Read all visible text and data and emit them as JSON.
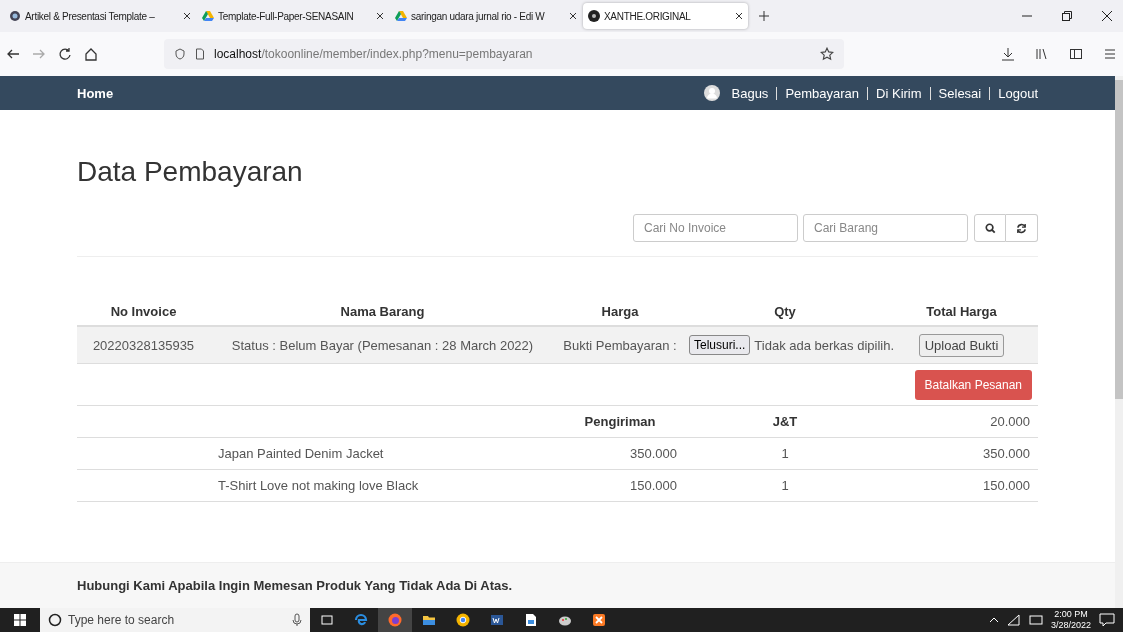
{
  "browser": {
    "tabs": [
      {
        "title": "Artikel & Presentasi Template – ",
        "kind": "globe",
        "selected": false
      },
      {
        "title": "Template-Full-Paper-SENASAIN",
        "kind": "drive",
        "selected": false
      },
      {
        "title": "saringan udara jurnal rio - Edi W",
        "kind": "drive",
        "selected": false
      },
      {
        "title": "XANTHE.ORIGINAL",
        "kind": "logo",
        "selected": true
      }
    ],
    "address": {
      "host": "localhost",
      "path": "/tokoonline/member/index.php?menu=pembayaran"
    }
  },
  "nav": {
    "brand": "Home",
    "user": "Bagus",
    "links": [
      "Pembayaran",
      "Di Kirim",
      "Selesai",
      "Logout"
    ]
  },
  "page": {
    "title": "Data Pembayaran",
    "search": {
      "invoice_placeholder": "Cari No Invoice",
      "item_placeholder": "Cari Barang"
    },
    "table": {
      "columns": [
        "No Invoice",
        "Nama Barang",
        "Harga",
        "Qty",
        "Total Harga"
      ],
      "order": {
        "invoice": "20220328135935",
        "status": "Status : Belum Bayar (Pemesanan : 28 March 2022)",
        "proof_label": "Bukti Pembayaran :",
        "file_button": "Telusuri...",
        "file_status": "Tidak ada berkas dipilih.",
        "upload_button": "Upload Bukti"
      },
      "cancel_button": "Batalkan Pesanan",
      "shipping": {
        "label": "Pengiriman",
        "courier": "J&T",
        "cost": "20.000"
      },
      "items": [
        {
          "name": "Japan Painted Denim Jacket",
          "price": "350.000",
          "qty": "1",
          "total": "350.000"
        },
        {
          "name": "T-Shirt Love not making love Black",
          "price": "150.000",
          "qty": "1",
          "total": "150.000"
        }
      ]
    }
  },
  "footer": {
    "text": "Hubungi Kami Apabila Ingin Memesan Produk Yang Tidak Ada Di Atas."
  },
  "taskbar": {
    "search_placeholder": "Type here to search",
    "time": "2:00 PM",
    "date": "3/28/2022"
  }
}
